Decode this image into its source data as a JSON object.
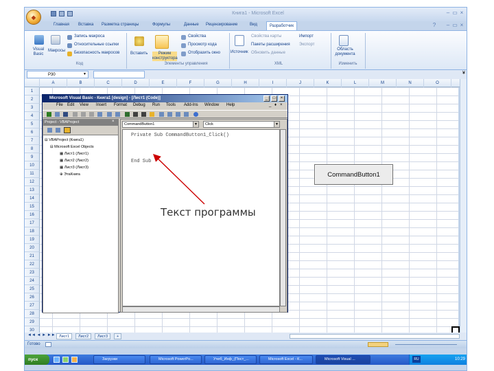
{
  "window": {
    "title": "Книга1 - Microsoft Excel"
  },
  "ribbon": {
    "tabs": [
      "Главная",
      "Вставка",
      "Разметка страницы",
      "Формулы",
      "Данные",
      "Рецензирование",
      "Вид",
      "Разработчик"
    ],
    "active_tab": "Разработчик",
    "code_group": {
      "visual_basic": "Visual Basic",
      "macros": "Макросы",
      "record_macro": "Запись макроса",
      "relative_refs": "Относительные ссылки",
      "macro_security": "Безопасность макросов",
      "label": "Код"
    },
    "controls_group": {
      "insert": "Вставить",
      "design_mode": "Режим конструктора",
      "properties": "Свойства",
      "view_code": "Просмотр кода",
      "run_dialog": "Отобразить окно",
      "label": "Элементы управления"
    },
    "xml_group": {
      "source": "Источник",
      "map_properties": "Свойства карты",
      "expansion_packs": "Пакеты расширения",
      "refresh_data": "Обновить данные",
      "import": "Импорт",
      "export": "Экспорт",
      "label": "XML"
    },
    "modify_group": {
      "doc_panel": "Область документа",
      "label": "Изменить"
    }
  },
  "formula_bar": {
    "name_box": "P30"
  },
  "columns": [
    "A",
    "B",
    "C",
    "D",
    "E",
    "F",
    "G",
    "H",
    "I",
    "J",
    "K",
    "L",
    "M",
    "N",
    "O"
  ],
  "rows": [
    "1",
    "2",
    "3",
    "4",
    "5",
    "6",
    "7",
    "8",
    "9",
    "10",
    "11",
    "12",
    "13",
    "14",
    "15",
    "16",
    "17",
    "18",
    "19",
    "20",
    "21",
    "22",
    "23",
    "24",
    "25",
    "26",
    "27",
    "28",
    "29",
    "30"
  ],
  "sheet_tabs": [
    "Лист1",
    "Лист2",
    "Лист3"
  ],
  "status_bar": {
    "ready": "Готово"
  },
  "vba": {
    "title": "Microsoft Visual Basic - Книга1 [design] - [Лист1 (Code)]",
    "menu": [
      "File",
      "Edit",
      "View",
      "Insert",
      "Format",
      "Debug",
      "Run",
      "Tools",
      "Add-Ins",
      "Window",
      "Help"
    ],
    "project_title": "Project - VBAProject",
    "tree": [
      "VBAProject (Книга1)",
      "Microsoft Excel Objects",
      "Лист1 (Лист1)",
      "Лист2 (Лист2)",
      "Лист3 (Лист3)",
      "ЭтаКнига"
    ],
    "object_combo": "CommandButton1",
    "proc_combo": "Click",
    "code_lines": [
      "Private Sub CommandButton1_Click()",
      "End Sub"
    ]
  },
  "sheet_button": {
    "label": "CommandButton1"
  },
  "annotation": {
    "text": "Текст программы"
  },
  "taskbar": {
    "start": "пуск",
    "tasks": [
      "Загрузки",
      "Microsoft PowerPo...",
      "Учеб_Инф_(Пост_...",
      "Microsoft Excel - К...",
      "Microsoft Visual ..."
    ],
    "language": "RU",
    "clock": "10:29"
  },
  "colors": {
    "ribbon_blue": "#c4d5eb",
    "vba_title": "#0a246a",
    "arrow": "#cc0000"
  }
}
